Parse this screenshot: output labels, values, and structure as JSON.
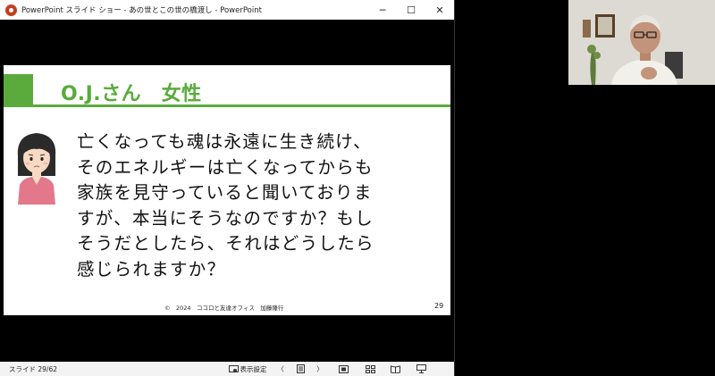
{
  "window": {
    "title": "PowerPoint スライド ショー  -  あの世とこの世の橋渡し - PowerPoint",
    "minimize": "─",
    "maximize": "☐",
    "close": "✕"
  },
  "slide": {
    "heading": "O.J.さん　女性",
    "body_lines": [
      "亡くなっても魂は永遠に生き続け、",
      "そのエネルギーは亡くなってからも",
      "家族を見守っていると聞いておりま",
      "すが、本当にそうなのですか？もし",
      "そうだとしたら、それはどうしたら",
      "感じられますか？"
    ],
    "footer": "©　2024　ココロと友達オフィス　加藤隆行",
    "number": "29"
  },
  "statusbar": {
    "slide_count": "スライド 29/62",
    "display_settings": "表示設定",
    "prev": "〈",
    "next": "〉"
  },
  "colors": {
    "accent": "#5aab3c",
    "avatar_shirt": "#e3788b",
    "avatar_skin": "#f7d9c4"
  }
}
